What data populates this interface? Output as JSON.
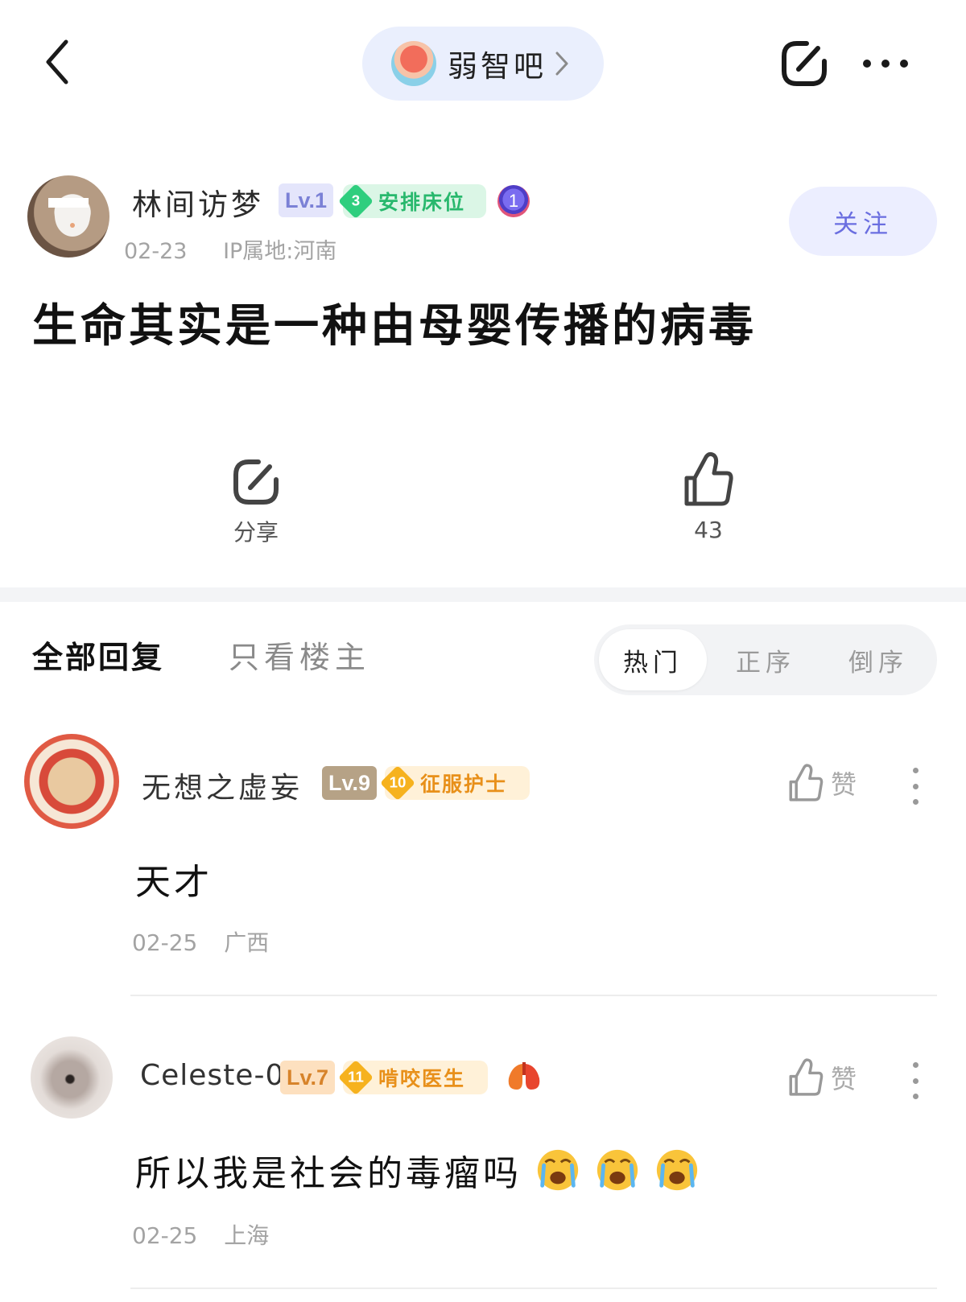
{
  "topbar": {
    "forum_name": "弱智吧"
  },
  "author": {
    "name": "林间访梦",
    "level": "Lv.1",
    "title_level": "3",
    "title": "安排床位",
    "medal": "1",
    "date": "02-23",
    "ip": "IP属地:河南",
    "follow_label": "关注"
  },
  "post": {
    "title": "生命其实是一种由母婴传播的病毒"
  },
  "actions": {
    "share_label": "分享",
    "like_count": "43"
  },
  "tabs": {
    "all": "全部回复",
    "op_only": "只看楼主",
    "sort": [
      "热门",
      "正序",
      "倒序"
    ],
    "active_sort": "热门"
  },
  "comments": [
    {
      "name": "无想之虚妄",
      "level": "Lv.9",
      "title_level": "10",
      "title": "征服护士",
      "like_label": "赞",
      "body": "天才",
      "date": "02-25",
      "location": "广西"
    },
    {
      "name": "Celeste-0",
      "level": "Lv.7",
      "title_level": "11",
      "title": "啃咬医生",
      "like_label": "赞",
      "body": "所以我是社会的毒瘤吗",
      "emoji": [
        "crying-face-icon",
        "crying-face-icon",
        "crying-face-icon"
      ],
      "date": "02-25",
      "location": "上海"
    }
  ],
  "colors": {
    "pill_bg": "#eaeffd",
    "follow_text": "#6a6ee0",
    "green_badge": "#2fce7e",
    "orange_badge": "#f6b21e"
  }
}
